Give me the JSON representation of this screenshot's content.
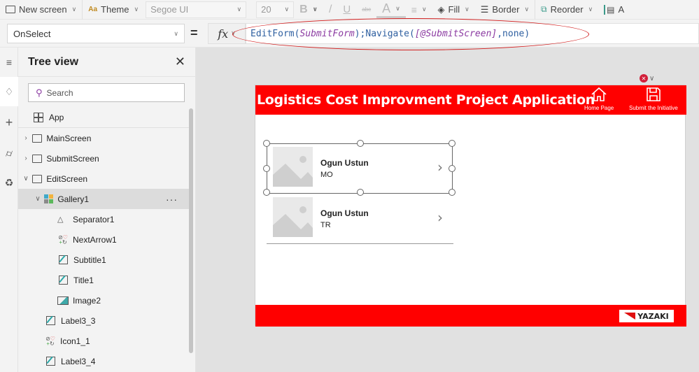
{
  "toolbar": {
    "new_screen": "New screen",
    "theme": "Theme",
    "font_family": "Segoe UI",
    "font_size": "20",
    "bold": "B",
    "italic": "/",
    "underline": "U",
    "strikethrough": "abc",
    "font_color": "A",
    "fill": "Fill",
    "border": "Border",
    "reorder": "Reorder",
    "align": "A"
  },
  "formula_bar": {
    "property": "OnSelect",
    "equals": "=",
    "fx": "fx",
    "formula_parts": {
      "p1": "EditForm(",
      "p2": "SubmitForm",
      "p3": ");Navigate(",
      "p4": "[@SubmitScreen]",
      "p5": ",none)"
    }
  },
  "tree_view": {
    "title": "Tree view",
    "search_placeholder": "Search",
    "items": [
      {
        "label": "App"
      },
      {
        "label": "MainScreen"
      },
      {
        "label": "SubmitScreen"
      },
      {
        "label": "EditScreen"
      },
      {
        "label": "Gallery1"
      },
      {
        "label": "Separator1"
      },
      {
        "label": "NextArrow1"
      },
      {
        "label": "Subtitle1"
      },
      {
        "label": "Title1"
      },
      {
        "label": "Image2"
      },
      {
        "label": "Label3_3"
      },
      {
        "label": "Icon1_1"
      },
      {
        "label": "Label3_4"
      }
    ],
    "more": "···"
  },
  "app": {
    "title": "Logistics Cost Improvment Project Application",
    "home_label": "Home Page",
    "submit_label": "Submit the Initiative",
    "brand": "YAZAKI",
    "accent_color": "#ff0000",
    "gallery": [
      {
        "title": "Ogun Ustun",
        "subtitle": "MO"
      },
      {
        "title": "Ogun Ustun",
        "subtitle": "TR"
      }
    ]
  }
}
